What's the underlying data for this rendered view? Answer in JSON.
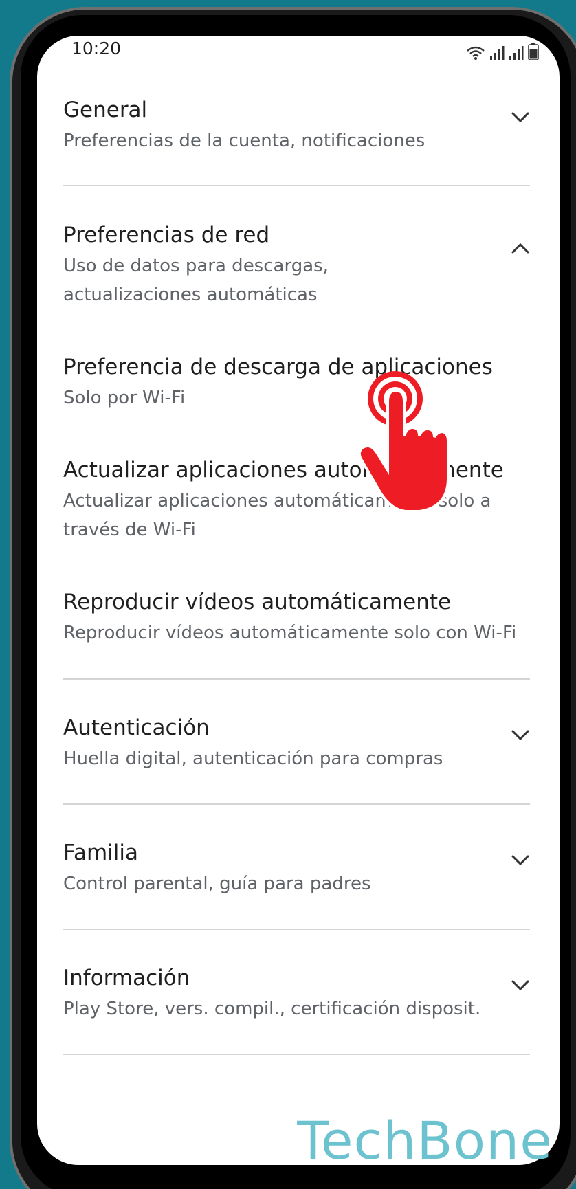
{
  "status": {
    "time": "10:20"
  },
  "sections": [
    {
      "title": "General",
      "subtitle": "Preferencias de la cuenta, notificaciones",
      "expanded": false
    },
    {
      "title": "Preferencias de red",
      "subtitle": "Uso de datos para descargas, actualizaciones automáticas",
      "expanded": true
    },
    {
      "title": "Autenticación",
      "subtitle": "Huella digital, autenticación para compras",
      "expanded": false
    },
    {
      "title": "Familia",
      "subtitle": "Control parental, guía para padres",
      "expanded": false
    },
    {
      "title": "Información",
      "subtitle": "Play Store, vers. compil., certificación disposit.",
      "expanded": false
    }
  ],
  "network_items": [
    {
      "title": "Preferencia de descarga de aplicaciones",
      "description": "Solo por Wi-Fi"
    },
    {
      "title": "Actualizar aplicaciones automáticamente",
      "description": "Actualizar aplicaciones automáticamente solo a través de Wi-Fi"
    },
    {
      "title": "Reproducir vídeos automáticamente",
      "description": "Reproducir vídeos automáticamente solo con Wi-Fi"
    }
  ],
  "watermark": "TechBone",
  "colors": {
    "background": "#127a8a",
    "tap_hand": "#ee1c24",
    "watermark": "#6cc3cf"
  }
}
